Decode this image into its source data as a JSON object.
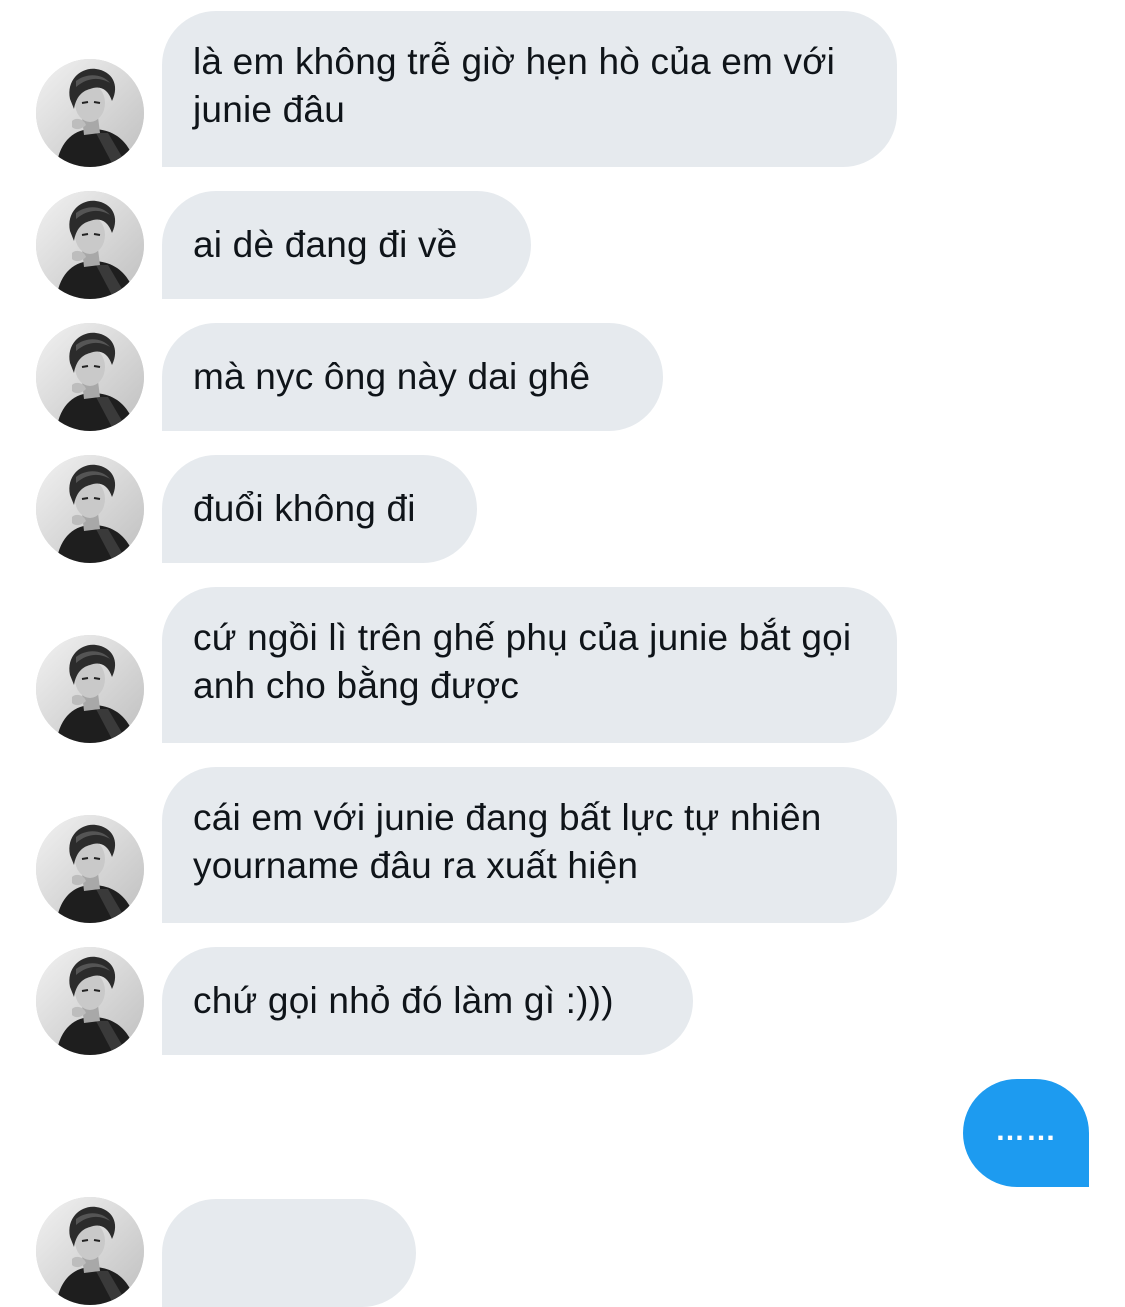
{
  "conversation": {
    "received": [
      {
        "text": "là em không trễ giờ hẹn hò của em với junie đâu"
      },
      {
        "text": "ai dè đang đi về"
      },
      {
        "text": "mà nyc ông này dai ghê"
      },
      {
        "text": "đuổi không đi"
      },
      {
        "text": "cứ ngồi lì trên ghế phụ của junie bắt gọi anh cho bằng được"
      },
      {
        "text": "cái em với junie đang bất lực tự nhiên yourname đâu ra xuất hiện"
      },
      {
        "text": "chứ gọi nhỏ đó làm gì :)))"
      }
    ],
    "sent": [
      {
        "text": "……"
      }
    ]
  },
  "colors": {
    "received_bubble": "#e6eaee",
    "sent_bubble": "#1d9bf0",
    "text": "#0f1419"
  },
  "icons": {
    "avatar": "profile-photo-avatar"
  }
}
